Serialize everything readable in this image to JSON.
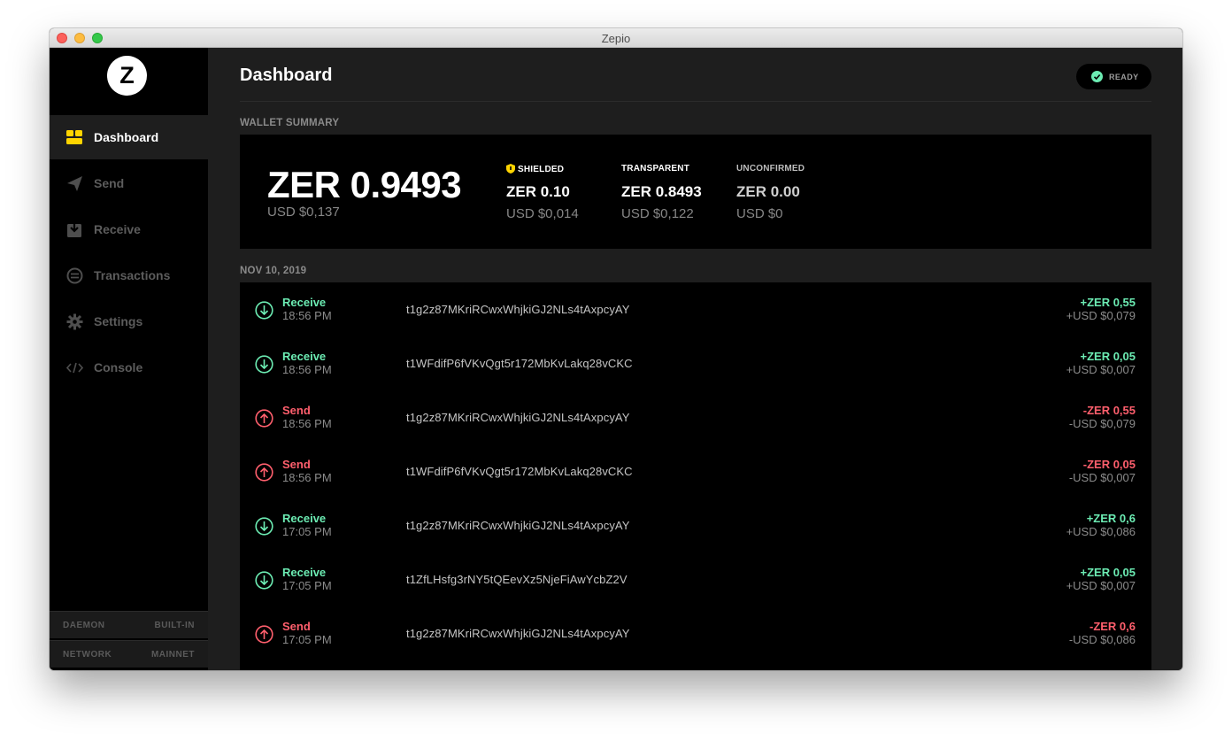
{
  "window": {
    "title": "Zepio"
  },
  "logo": {
    "letter": "Z"
  },
  "sidebar": {
    "items": [
      {
        "label": "Dashboard",
        "icon": "dashboard-icon",
        "active": true
      },
      {
        "label": "Send",
        "icon": "send-icon",
        "active": false
      },
      {
        "label": "Receive",
        "icon": "receive-icon",
        "active": false
      },
      {
        "label": "Transactions",
        "icon": "transactions-icon",
        "active": false
      },
      {
        "label": "Settings",
        "icon": "gear-icon",
        "active": false
      },
      {
        "label": "Console",
        "icon": "code-icon",
        "active": false
      }
    ],
    "status": [
      {
        "key": "DAEMON",
        "value": "BUILT-IN"
      },
      {
        "key": "NETWORK",
        "value": "MAINNET"
      }
    ]
  },
  "header": {
    "title": "Dashboard",
    "status": "READY"
  },
  "summary": {
    "label": "WALLET SUMMARY",
    "total": "ZER 0.9493",
    "total_usd": "USD $0,137",
    "shielded": {
      "label": "SHIELDED",
      "amount": "ZER 0.10",
      "usd": "USD $0,014"
    },
    "transparent": {
      "label": "TRANSPARENT",
      "amount": "ZER 0.8493",
      "usd": "USD $0,122"
    },
    "unconfirmed": {
      "label": "UNCONFIRMED",
      "amount": "ZER 0.00",
      "usd": "USD $0"
    }
  },
  "transactions": {
    "date": "NOV 10, 2019",
    "rows": [
      {
        "type": "Receive",
        "time": "18:56 PM",
        "address": "t1g2z87MKriRCwxWhjkiGJ2NLs4tAxpcyAY",
        "amount": "+ZER 0,55",
        "usd": "+USD $0,079"
      },
      {
        "type": "Receive",
        "time": "18:56 PM",
        "address": "t1WFdifP6fVKvQgt5r172MbKvLakq28vCKC",
        "amount": "+ZER 0,05",
        "usd": "+USD $0,007"
      },
      {
        "type": "Send",
        "time": "18:56 PM",
        "address": "t1g2z87MKriRCwxWhjkiGJ2NLs4tAxpcyAY",
        "amount": "-ZER 0,55",
        "usd": "-USD $0,079"
      },
      {
        "type": "Send",
        "time": "18:56 PM",
        "address": "t1WFdifP6fVKvQgt5r172MbKvLakq28vCKC",
        "amount": "-ZER 0,05",
        "usd": "-USD $0,007"
      },
      {
        "type": "Receive",
        "time": "17:05 PM",
        "address": "t1g2z87MKriRCwxWhjkiGJ2NLs4tAxpcyAY",
        "amount": "+ZER 0,6",
        "usd": "+USD $0,086"
      },
      {
        "type": "Receive",
        "time": "17:05 PM",
        "address": "t1ZfLHsfg3rNY5tQEevXz5NjeFiAwYcbZ2V",
        "amount": "+ZER 0,05",
        "usd": "+USD $0,007"
      },
      {
        "type": "Send",
        "time": "17:05 PM",
        "address": "t1g2z87MKriRCwxWhjkiGJ2NLs4tAxpcyAY",
        "amount": "-ZER 0,6",
        "usd": "-USD $0,086"
      }
    ]
  },
  "colors": {
    "receive": "#6cecb3",
    "send": "#ff5f6d",
    "accent": "#ffd400",
    "ready": "#6cecb3"
  }
}
